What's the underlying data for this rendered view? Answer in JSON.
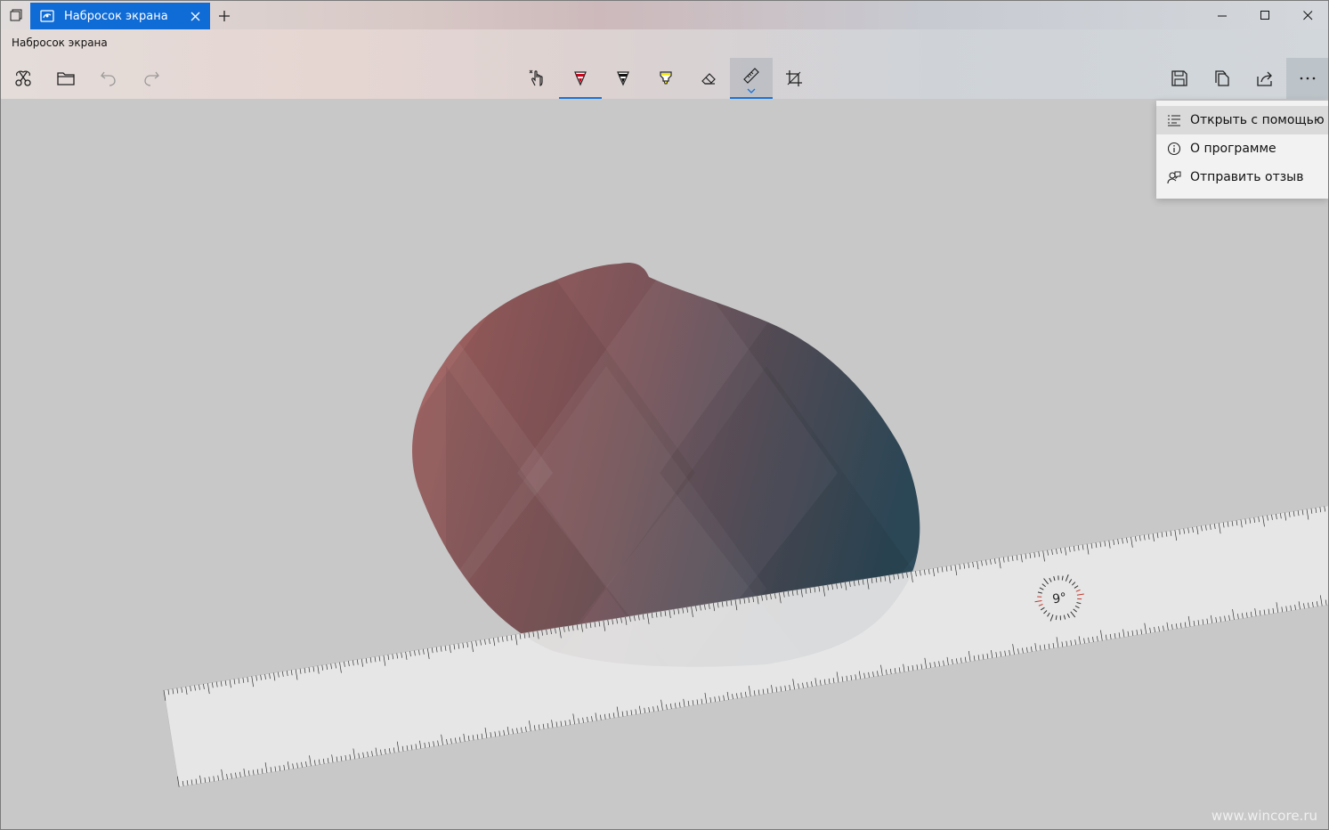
{
  "tab": {
    "title": "Набросок экрана"
  },
  "app": {
    "title": "Набросок экрана"
  },
  "toolbar": {
    "left": [
      "snip-icon",
      "folder-icon",
      "undo-icon",
      "redo-icon"
    ],
    "center": [
      "touch-writing-icon",
      "ballpoint-pen-icon",
      "pencil-icon",
      "highlighter-icon",
      "eraser-icon",
      "ruler-icon",
      "crop-icon"
    ],
    "right": [
      "save-icon",
      "copy-icon",
      "share-icon",
      "more-icon"
    ]
  },
  "menu": {
    "items": [
      {
        "label": "Открыть с помощью",
        "icon": "open-with-icon"
      },
      {
        "label": "О программе",
        "icon": "info-icon"
      },
      {
        "label": "Отправить отзыв",
        "icon": "feedback-icon"
      }
    ]
  },
  "ruler": {
    "angle_label": "9°",
    "angle": 9
  },
  "watermark": "www.wincore.ru",
  "colors": {
    "accent": "#0f6bd6",
    "pen": "#d0021b",
    "highlighter": "#f7e600"
  }
}
